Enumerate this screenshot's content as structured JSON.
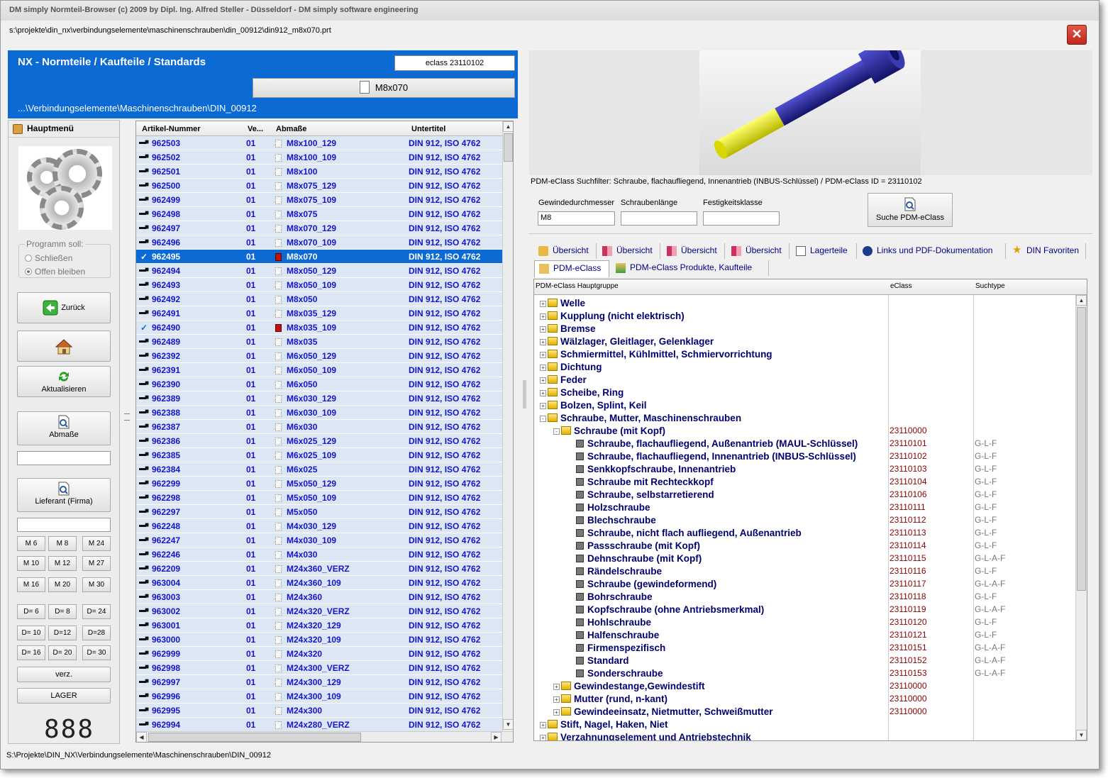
{
  "window": {
    "title": "DM simply Normteil-Browser  (c) 2009 by Dipl. Ing. Alfred Steller - Düsseldorf - DM simply software engineering",
    "file_path": "s:\\projekte\\din_nx\\verbindungselemente\\maschinenschrauben\\din_00912\\din912_m8x070.prt",
    "close_label": "✕"
  },
  "header": {
    "title": "NX - Normteile / Kaufteile / Standards",
    "eclass": "eclass 23110102",
    "part_button": "M8x070",
    "path": "...\\Verbindungselemente\\Maschinenschrauben\\DIN_00912"
  },
  "left": {
    "menu_title": "Hauptmenü",
    "program_group": "Programm soll:",
    "radio_close": "Schließen",
    "radio_open": "Offen bleiben",
    "back": "Zurück",
    "refresh": "Aktualisieren",
    "dims": "Abmaße",
    "supplier": "Lieferant (Firma)",
    "m_buttons": [
      "M 6",
      "M 8",
      "M 24",
      "M 10",
      "M 12",
      "M 27",
      "M 16",
      "M 20",
      "M 30"
    ],
    "d_buttons": [
      "D= 6",
      "D= 8",
      "D= 24",
      "D= 10",
      "D=12",
      "D=28",
      "D= 16",
      "D= 20",
      "D= 30"
    ],
    "verz": "verz.",
    "lager": "LAGER",
    "display": "888"
  },
  "grid": {
    "columns": [
      "Artikel-Nummer",
      "Ve...",
      "Abmaße",
      "Untertitel"
    ],
    "rows": [
      {
        "id": "962503",
        "ver": "01",
        "dim": "M8x100_129",
        "sub": "DIN 912, ISO 4762",
        "check": false,
        "red": false,
        "sel": false
      },
      {
        "id": "962502",
        "ver": "01",
        "dim": "M8x100_109",
        "sub": "DIN 912, ISO 4762",
        "check": false,
        "red": false,
        "sel": false
      },
      {
        "id": "962501",
        "ver": "01",
        "dim": "M8x100",
        "sub": "DIN 912, ISO 4762",
        "check": false,
        "red": false,
        "sel": false
      },
      {
        "id": "962500",
        "ver": "01",
        "dim": "M8x075_129",
        "sub": "DIN 912, ISO 4762",
        "check": false,
        "red": false,
        "sel": false
      },
      {
        "id": "962499",
        "ver": "01",
        "dim": "M8x075_109",
        "sub": "DIN 912, ISO 4762",
        "check": false,
        "red": false,
        "sel": false
      },
      {
        "id": "962498",
        "ver": "01",
        "dim": "M8x075",
        "sub": "DIN 912, ISO 4762",
        "check": false,
        "red": false,
        "sel": false
      },
      {
        "id": "962497",
        "ver": "01",
        "dim": "M8x070_129",
        "sub": "DIN 912, ISO 4762",
        "check": false,
        "red": false,
        "sel": false
      },
      {
        "id": "962496",
        "ver": "01",
        "dim": "M8x070_109",
        "sub": "DIN 912, ISO 4762",
        "check": false,
        "red": false,
        "sel": false
      },
      {
        "id": "962495",
        "ver": "01",
        "dim": "M8x070",
        "sub": "DIN 912, ISO 4762",
        "check": true,
        "red": true,
        "sel": true
      },
      {
        "id": "962494",
        "ver": "01",
        "dim": "M8x050_129",
        "sub": "DIN 912, ISO 4762",
        "check": false,
        "red": false,
        "sel": false
      },
      {
        "id": "962493",
        "ver": "01",
        "dim": "M8x050_109",
        "sub": "DIN 912, ISO 4762",
        "check": false,
        "red": false,
        "sel": false
      },
      {
        "id": "962492",
        "ver": "01",
        "dim": "M8x050",
        "sub": "DIN 912, ISO 4762",
        "check": false,
        "red": false,
        "sel": false
      },
      {
        "id": "962491",
        "ver": "01",
        "dim": "M8x035_129",
        "sub": "DIN 912, ISO 4762",
        "check": false,
        "red": false,
        "sel": false
      },
      {
        "id": "962490",
        "ver": "01",
        "dim": "M8x035_109",
        "sub": "DIN 912, ISO 4762",
        "check": true,
        "red": true,
        "sel": false
      },
      {
        "id": "962489",
        "ver": "01",
        "dim": "M8x035",
        "sub": "DIN 912, ISO 4762",
        "check": false,
        "red": false,
        "sel": false
      },
      {
        "id": "962392",
        "ver": "01",
        "dim": "M6x050_129",
        "sub": "DIN 912, ISO 4762",
        "check": false,
        "red": false,
        "sel": false
      },
      {
        "id": "962391",
        "ver": "01",
        "dim": "M6x050_109",
        "sub": "DIN 912, ISO 4762",
        "check": false,
        "red": false,
        "sel": false
      },
      {
        "id": "962390",
        "ver": "01",
        "dim": "M6x050",
        "sub": "DIN 912, ISO 4762",
        "check": false,
        "red": false,
        "sel": false
      },
      {
        "id": "962389",
        "ver": "01",
        "dim": "M6x030_129",
        "sub": "DIN 912, ISO 4762",
        "check": false,
        "red": false,
        "sel": false
      },
      {
        "id": "962388",
        "ver": "01",
        "dim": "M6x030_109",
        "sub": "DIN 912, ISO 4762",
        "check": false,
        "red": false,
        "sel": false
      },
      {
        "id": "962387",
        "ver": "01",
        "dim": "M6x030",
        "sub": "DIN 912, ISO 4762",
        "check": false,
        "red": false,
        "sel": false
      },
      {
        "id": "962386",
        "ver": "01",
        "dim": "M6x025_129",
        "sub": "DIN 912, ISO 4762",
        "check": false,
        "red": false,
        "sel": false
      },
      {
        "id": "962385",
        "ver": "01",
        "dim": "M6x025_109",
        "sub": "DIN 912, ISO 4762",
        "check": false,
        "red": false,
        "sel": false
      },
      {
        "id": "962384",
        "ver": "01",
        "dim": "M6x025",
        "sub": "DIN 912, ISO 4762",
        "check": false,
        "red": false,
        "sel": false
      },
      {
        "id": "962299",
        "ver": "01",
        "dim": "M5x050_129",
        "sub": "DIN 912, ISO 4762",
        "check": false,
        "red": false,
        "sel": false
      },
      {
        "id": "962298",
        "ver": "01",
        "dim": "M5x050_109",
        "sub": "DIN 912, ISO 4762",
        "check": false,
        "red": false,
        "sel": false
      },
      {
        "id": "962297",
        "ver": "01",
        "dim": "M5x050",
        "sub": "DIN 912, ISO 4762",
        "check": false,
        "red": false,
        "sel": false
      },
      {
        "id": "962248",
        "ver": "01",
        "dim": "M4x030_129",
        "sub": "DIN 912, ISO 4762",
        "check": false,
        "red": false,
        "sel": false
      },
      {
        "id": "962247",
        "ver": "01",
        "dim": "M4x030_109",
        "sub": "DIN 912, ISO 4762",
        "check": false,
        "red": false,
        "sel": false
      },
      {
        "id": "962246",
        "ver": "01",
        "dim": "M4x030",
        "sub": "DIN 912, ISO 4762",
        "check": false,
        "red": false,
        "sel": false
      },
      {
        "id": "962209",
        "ver": "01",
        "dim": "M24x360_VERZ",
        "sub": "DIN 912, ISO 4762",
        "check": false,
        "red": false,
        "sel": false
      },
      {
        "id": "963004",
        "ver": "01",
        "dim": "M24x360_109",
        "sub": "DIN 912, ISO 4762",
        "check": false,
        "red": false,
        "sel": false
      },
      {
        "id": "963003",
        "ver": "01",
        "dim": "M24x360",
        "sub": "DIN 912, ISO 4762",
        "check": false,
        "red": false,
        "sel": false
      },
      {
        "id": "963002",
        "ver": "01",
        "dim": "M24x320_VERZ",
        "sub": "DIN 912, ISO 4762",
        "check": false,
        "red": false,
        "sel": false
      },
      {
        "id": "963001",
        "ver": "01",
        "dim": "M24x320_129",
        "sub": "DIN 912, ISO 4762",
        "check": false,
        "red": false,
        "sel": false
      },
      {
        "id": "963000",
        "ver": "01",
        "dim": "M24x320_109",
        "sub": "DIN 912, ISO 4762",
        "check": false,
        "red": false,
        "sel": false
      },
      {
        "id": "962999",
        "ver": "01",
        "dim": "M24x320",
        "sub": "DIN 912, ISO 4762",
        "check": false,
        "red": false,
        "sel": false
      },
      {
        "id": "962998",
        "ver": "01",
        "dim": "M24x300_VERZ",
        "sub": "DIN 912, ISO 4762",
        "check": false,
        "red": false,
        "sel": false
      },
      {
        "id": "962997",
        "ver": "01",
        "dim": "M24x300_129",
        "sub": "DIN 912, ISO 4762",
        "check": false,
        "red": false,
        "sel": false
      },
      {
        "id": "962996",
        "ver": "01",
        "dim": "M24x300_109",
        "sub": "DIN 912, ISO 4762",
        "check": false,
        "red": false,
        "sel": false
      },
      {
        "id": "962995",
        "ver": "01",
        "dim": "M24x300",
        "sub": "DIN 912, ISO 4762",
        "check": false,
        "red": false,
        "sel": false
      },
      {
        "id": "962994",
        "ver": "01",
        "dim": "M24x280_VERZ",
        "sub": "DIN 912, ISO 4762",
        "check": false,
        "red": false,
        "sel": false
      }
    ]
  },
  "right": {
    "filter_text": "PDM-eClass Suchfilter: Schraube, flachaufliegend, Innenantrieb (INBUS-Schlüssel) / PDM-eClass ID = 23110102",
    "label_diameter": "Gewindedurchmesser",
    "label_length": "Schraubenlänge",
    "label_strength": "Festigkeitsklasse",
    "value_diameter": "M8",
    "search_button": "Suche PDM-eClass",
    "tabs": [
      "Übersicht",
      "Übersicht",
      "Übersicht",
      "Übersicht",
      "Lagerteile",
      "Links und PDF-Dokumentation",
      "DIN Favoriten",
      "PDM-eClass",
      "PDM-eClass Produkte, Kaufteile"
    ],
    "tree_columns": [
      "PDM-eClass Hauptgruppe",
      "eClass",
      "Suchtype"
    ],
    "tree": [
      {
        "level": 0,
        "pm": "+",
        "icon": "folder",
        "label": "Welle",
        "ec": "",
        "st": ""
      },
      {
        "level": 0,
        "pm": "+",
        "icon": "folder",
        "label": "Kupplung (nicht elektrisch)",
        "ec": "",
        "st": ""
      },
      {
        "level": 0,
        "pm": "+",
        "icon": "folder",
        "label": "Bremse",
        "ec": "",
        "st": ""
      },
      {
        "level": 0,
        "pm": "+",
        "icon": "folder",
        "label": "Wälzlager, Gleitlager, Gelenklager",
        "ec": "",
        "st": ""
      },
      {
        "level": 0,
        "pm": "+",
        "icon": "folder",
        "label": "Schmiermittel, Kühlmittel, Schmiervorrichtung",
        "ec": "",
        "st": ""
      },
      {
        "level": 0,
        "pm": "+",
        "icon": "folder",
        "label": "Dichtung",
        "ec": "",
        "st": ""
      },
      {
        "level": 0,
        "pm": "+",
        "icon": "folder",
        "label": "Feder",
        "ec": "",
        "st": ""
      },
      {
        "level": 0,
        "pm": "+",
        "icon": "folder",
        "label": "Scheibe, Ring",
        "ec": "",
        "st": ""
      },
      {
        "level": 0,
        "pm": "+",
        "icon": "folder",
        "label": "Bolzen, Splint, Keil",
        "ec": "",
        "st": ""
      },
      {
        "level": 0,
        "pm": "-",
        "icon": "folder",
        "label": "Schraube, Mutter, Maschinenschrauben",
        "ec": "",
        "st": ""
      },
      {
        "level": 1,
        "pm": "-",
        "icon": "folder",
        "label": "Schraube (mit Kopf)",
        "ec": "23110000",
        "st": ""
      },
      {
        "level": 2,
        "pm": "",
        "icon": "box",
        "label": "Schraube, flachaufliegend, Außenantrieb (MAUL-Schlüssel)",
        "ec": "23110101",
        "st": "G-L-F"
      },
      {
        "level": 2,
        "pm": "",
        "icon": "box",
        "label": "Schraube, flachaufliegend, Innenantrieb (INBUS-Schlüssel)",
        "ec": "23110102",
        "st": "G-L-F"
      },
      {
        "level": 2,
        "pm": "",
        "icon": "box",
        "label": "Senkkopfschraube, Innenantrieb",
        "ec": "23110103",
        "st": "G-L-F"
      },
      {
        "level": 2,
        "pm": "",
        "icon": "box",
        "label": "Schraube mit Rechteckkopf",
        "ec": "23110104",
        "st": "G-L-F"
      },
      {
        "level": 2,
        "pm": "",
        "icon": "box",
        "label": "Schraube, selbstarretierend",
        "ec": "23110106",
        "st": "G-L-F"
      },
      {
        "level": 2,
        "pm": "",
        "icon": "box",
        "label": "Holzschraube",
        "ec": "23110111",
        "st": "G-L-F"
      },
      {
        "level": 2,
        "pm": "",
        "icon": "box",
        "label": "Blechschraube",
        "ec": "23110112",
        "st": "G-L-F"
      },
      {
        "level": 2,
        "pm": "",
        "icon": "box",
        "label": "Schraube, nicht flach aufliegend, Außenantrieb",
        "ec": "23110113",
        "st": "G-L-F"
      },
      {
        "level": 2,
        "pm": "",
        "icon": "box",
        "label": "Passschraube (mit Kopf)",
        "ec": "23110114",
        "st": "G-L-F"
      },
      {
        "level": 2,
        "pm": "",
        "icon": "box",
        "label": "Dehnschraube (mit Kopf)",
        "ec": "23110115",
        "st": "G-L-A-F"
      },
      {
        "level": 2,
        "pm": "",
        "icon": "box",
        "label": "Rändelschraube",
        "ec": "23110116",
        "st": "G-L-F"
      },
      {
        "level": 2,
        "pm": "",
        "icon": "box",
        "label": "Schraube (gewindeformend)",
        "ec": "23110117",
        "st": "G-L-A-F"
      },
      {
        "level": 2,
        "pm": "",
        "icon": "box",
        "label": "Bohrschraube",
        "ec": "23110118",
        "st": "G-L-F"
      },
      {
        "level": 2,
        "pm": "",
        "icon": "box",
        "label": "Kopfschraube (ohne Antriebsmerkmal)",
        "ec": "23110119",
        "st": "G-L-A-F"
      },
      {
        "level": 2,
        "pm": "",
        "icon": "box",
        "label": "Hohlschraube",
        "ec": "23110120",
        "st": "G-L-F"
      },
      {
        "level": 2,
        "pm": "",
        "icon": "box",
        "label": "Halfenschraube",
        "ec": "23110121",
        "st": "G-L-F"
      },
      {
        "level": 2,
        "pm": "",
        "icon": "box",
        "label": "Firmenspezifisch",
        "ec": "23110151",
        "st": "G-L-A-F"
      },
      {
        "level": 2,
        "pm": "",
        "icon": "box",
        "label": "Standard",
        "ec": "23110152",
        "st": "G-L-A-F"
      },
      {
        "level": 2,
        "pm": "",
        "icon": "box",
        "label": "Sonderschraube",
        "ec": "23110153",
        "st": "G-L-A-F"
      },
      {
        "level": 1,
        "pm": "+",
        "icon": "folder",
        "label": "Gewindestange,Gewindestift",
        "ec": "23110000",
        "st": ""
      },
      {
        "level": 1,
        "pm": "+",
        "icon": "folder",
        "label": "Mutter (rund, n-kant)",
        "ec": "23110000",
        "st": ""
      },
      {
        "level": 1,
        "pm": "+",
        "icon": "folder",
        "label": "Gewindeeinsatz, Nietmutter, Schweißmutter",
        "ec": "23110000",
        "st": ""
      },
      {
        "level": 0,
        "pm": "+",
        "icon": "folder",
        "label": "Stift, Nagel, Haken, Niet",
        "ec": "",
        "st": ""
      },
      {
        "level": 0,
        "pm": "+",
        "icon": "folder",
        "label": "Verzahnungselement und Antriebstechnik",
        "ec": "",
        "st": ""
      }
    ]
  },
  "status": "S:\\Projekte\\DIN_NX\\Verbindungselemente\\Maschinenschrauben\\DIN_00912",
  "colors": {
    "accent": "#0b6ad3",
    "row_bg": "#dde7f3",
    "link": "#1414cc",
    "tree_text": "#00006e",
    "eclass_red": "#8a0000",
    "bolt_blue": "#2a2aa0",
    "bolt_yellow": "#f5f000"
  }
}
